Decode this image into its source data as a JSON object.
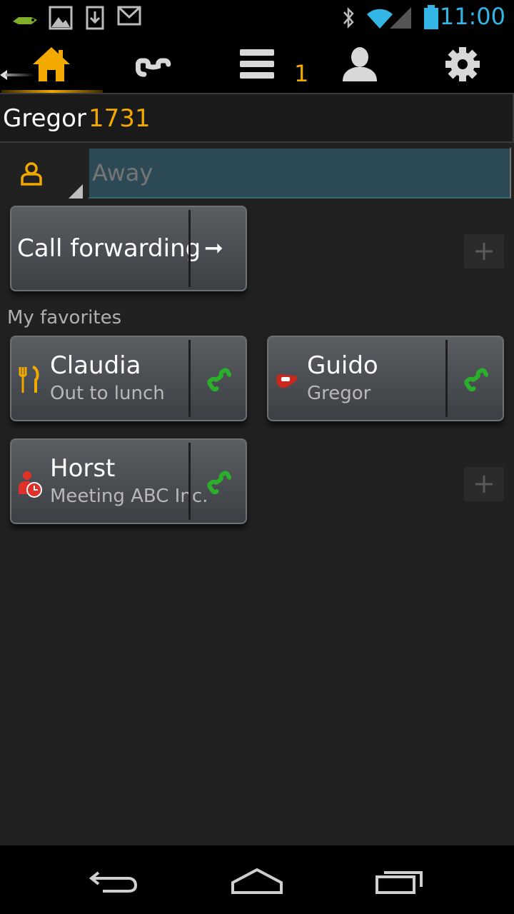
{
  "status_bar": {
    "time": "11:00",
    "icons": [
      "app-notification-icon",
      "image-icon",
      "download-icon",
      "gmail-icon",
      "bluetooth-icon",
      "wifi-icon",
      "signal-icon",
      "battery-icon"
    ]
  },
  "tabs": {
    "items": [
      "home",
      "calls",
      "list",
      "contacts",
      "settings"
    ],
    "active": "home",
    "list_badge": "1"
  },
  "user": {
    "name": "Gregor",
    "extension": "1731"
  },
  "presence": {
    "placeholder": "Away"
  },
  "call_forwarding": {
    "label": "Call forwarding",
    "arrow": "➞"
  },
  "favorites": {
    "section_label": "My favorites",
    "items": [
      {
        "name": "Claudia",
        "status": "Out to lunch",
        "status_icon": "lunch-icon"
      },
      {
        "name": "Guido",
        "status": "Gregor",
        "status_icon": "on-phone-icon"
      },
      {
        "name": "Horst",
        "status": "Meeting ABC Inc.",
        "status_icon": "meeting-icon"
      }
    ]
  },
  "colors": {
    "accent": "#f2a900",
    "system_blue": "#33b5e5",
    "call_green": "#2bb02b"
  }
}
